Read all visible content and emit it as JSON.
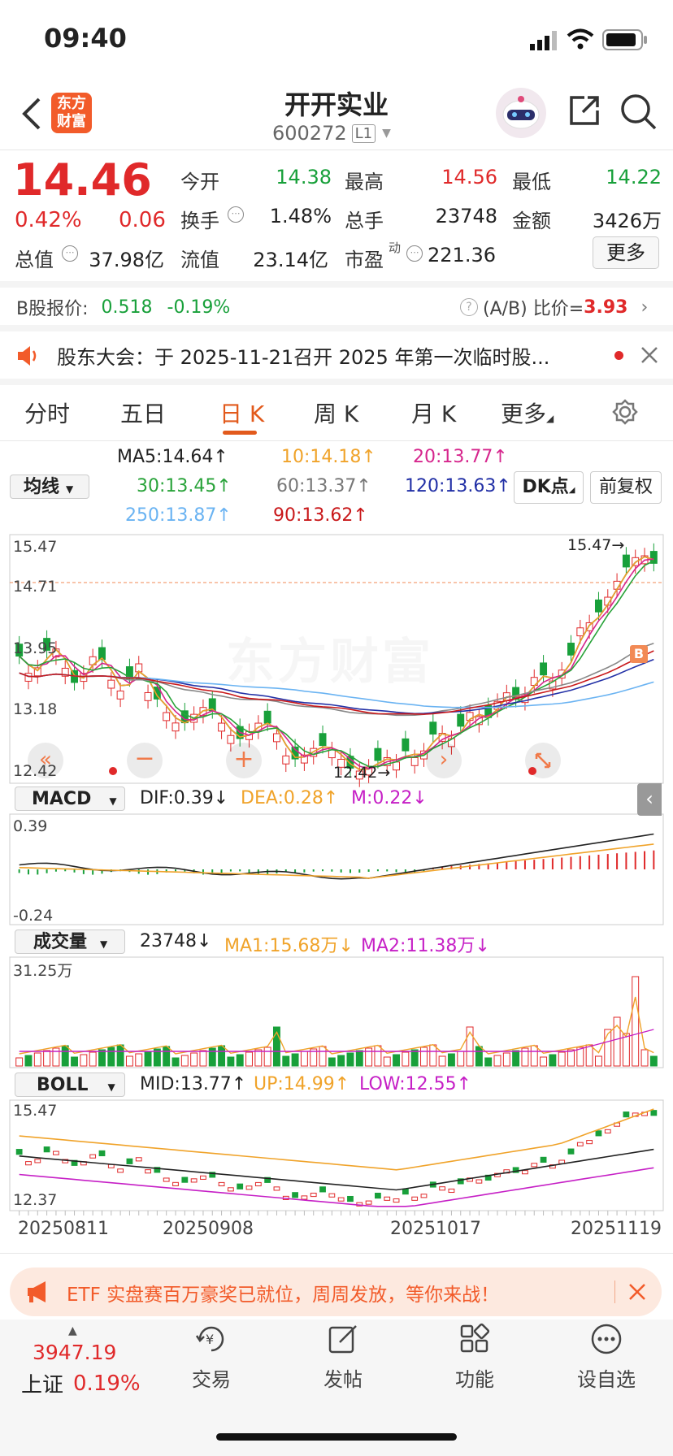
{
  "status": {
    "time": "09:40"
  },
  "header": {
    "title": "开开实业",
    "code": "600272",
    "code_badge": "L1",
    "logo_text": "东方\n财富"
  },
  "quote": {
    "price": "14.46",
    "pct": "0.42%",
    "chg": "0.06",
    "stats": [
      {
        "label": "今开",
        "value": "14.38",
        "color": "green"
      },
      {
        "label": "最高",
        "value": "14.56",
        "color": "red"
      },
      {
        "label": "最低",
        "value": "14.22",
        "color": "green"
      },
      {
        "label": "换手",
        "value": "1.48%",
        "color": "dark"
      },
      {
        "label": "总手",
        "value": "23748",
        "color": "dark"
      },
      {
        "label": "金额",
        "value": "3426万",
        "color": "dark"
      },
      {
        "label": "总值",
        "value": "37.98亿",
        "color": "dark"
      },
      {
        "label": "流值",
        "value": "23.14亿",
        "color": "dark"
      },
      {
        "label": "市盈",
        "value": "221.36",
        "color": "dark"
      }
    ],
    "pe_sup": "动",
    "more_label": "更多"
  },
  "bshare": {
    "label": "B股报价:",
    "price": "0.518",
    "pct": "-0.19%",
    "ratio_label": "(A/B) 比价=",
    "ratio": "3.93"
  },
  "notice": {
    "text": "股东大会：于 2025-11-21召开 2025 年第一次临时股..."
  },
  "tabs": [
    "分时",
    "五日",
    "日 K",
    "周 K",
    "月 K",
    "更多"
  ],
  "ma": {
    "selector": "均线",
    "ma5": "MA5:14.64",
    "ma10": "10:14.18",
    "ma20": "20:13.77",
    "ma30": "30:13.45",
    "ma60": "60:13.37",
    "ma120": "120:13.63",
    "ma250": "250:13.87",
    "ma90": "90:13.62",
    "dk": "DK点",
    "fq": "前复权"
  },
  "kchart": {
    "max": "15.47",
    "l2": "14.71",
    "l3": "13.95",
    "l4": "13.18",
    "min": "12.42",
    "max_mark": "15.47",
    "min_mark": "12.42",
    "watermark": "东方财富",
    "b_badge": "B"
  },
  "macd": {
    "selector": "MACD",
    "dif": "DIF:0.39",
    "dea": "DEA:0.28",
    "m": "M:0.22",
    "top": "0.39",
    "bottom": "-0.24"
  },
  "vol": {
    "selector": "成交量",
    "val": "23748",
    "ma1": "MA1:15.68万",
    "ma2": "MA2:11.38万",
    "top": "31.25万"
  },
  "boll": {
    "selector": "BOLL",
    "mid": "MID:13.77",
    "up": "UP:14.99",
    "low": "LOW:12.55",
    "top": "15.47",
    "bottom": "12.37"
  },
  "dates": [
    "20250811",
    "20250908",
    "20251017",
    "20251119"
  ],
  "banner": {
    "text": "ETF 实盘赛百万豪奖已就位，周周发放，等你来战！"
  },
  "bottom_nav": {
    "index_value": "3947.19",
    "index_name": "上证",
    "index_pct": "0.19%",
    "items": [
      "交易",
      "发帖",
      "功能",
      "设自选"
    ]
  }
}
